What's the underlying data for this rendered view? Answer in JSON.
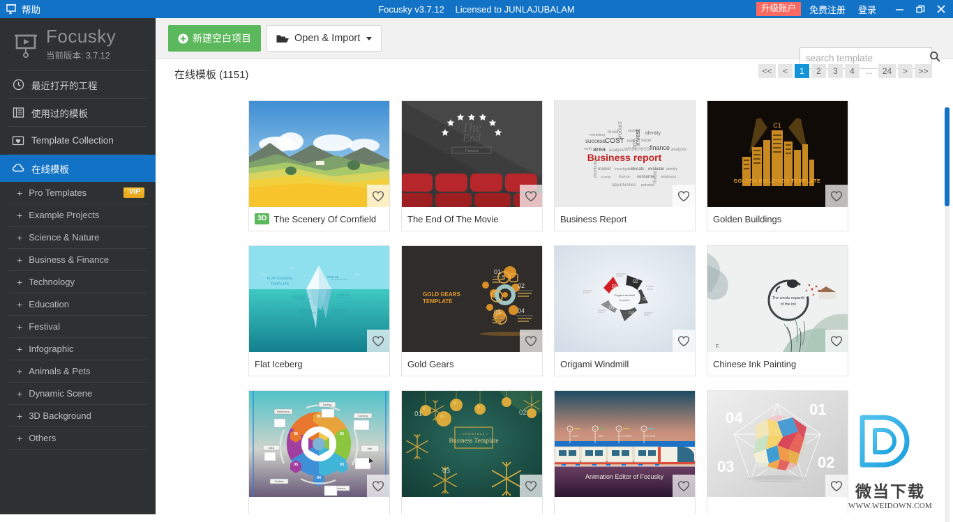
{
  "titlebar": {
    "app_icon": "focusky-app-icon",
    "help_label": "帮助",
    "product": "Focusky v3.7.12",
    "license": "Licensed to JUNLAJUBALAM",
    "upgrade_label": "升级账户",
    "register_label": "免费注册",
    "login_label": "登录",
    "minimize_icon": "minimize-icon",
    "maximize_icon": "restore-icon",
    "close_icon": "close-icon",
    "accent": "#1273c6",
    "upgrade_color": "#fa6a62"
  },
  "sidebar": {
    "brand_name": "Focusky",
    "version_label": "当前版本: 3.7.12",
    "items": [
      {
        "label": "最近打开的工程",
        "icon": "clock-icon",
        "active": false
      },
      {
        "label": "使用过的模板",
        "icon": "template-history-icon",
        "active": false
      },
      {
        "label": "Template Collection",
        "icon": "folder-heart-icon",
        "active": false
      },
      {
        "label": "在线模板",
        "icon": "cloud-icon",
        "active": true
      }
    ],
    "categories": [
      {
        "label": "Pro Templates",
        "vip": "VIP"
      },
      {
        "label": "Example Projects",
        "vip": ""
      },
      {
        "label": "Science & Nature",
        "vip": ""
      },
      {
        "label": "Business & Finance",
        "vip": ""
      },
      {
        "label": "Technology",
        "vip": ""
      },
      {
        "label": "Education",
        "vip": ""
      },
      {
        "label": "Festival",
        "vip": ""
      },
      {
        "label": "Infographic",
        "vip": ""
      },
      {
        "label": "Animals & Pets",
        "vip": ""
      },
      {
        "label": "Dynamic Scene",
        "vip": ""
      },
      {
        "label": "3D Background",
        "vip": ""
      },
      {
        "label": "Others",
        "vip": ""
      }
    ],
    "expand_symbol": "+"
  },
  "toolbar": {
    "new_project_label": "新建空白项目",
    "new_project_icon": "plus-circle-icon",
    "open_import_label": "Open & Import",
    "open_import_icon": "folder-open-icon",
    "dropdown_icon": "caret-down-icon"
  },
  "search": {
    "placeholder": "search template",
    "value": "",
    "icon": "search-icon"
  },
  "content": {
    "heading": "在线模板 (1151)",
    "pagination": {
      "first": "<<",
      "prev": "<",
      "pages": [
        "1",
        "2",
        "3",
        "4"
      ],
      "ellipsis": "...",
      "last_page": "24",
      "next": ">",
      "last": ">>",
      "current": "1",
      "active_color": "#1295d8"
    },
    "templates": [
      {
        "title": "The Scenery Of Cornfield",
        "badge": "3D",
        "art": "cornfield",
        "heart": "heart-outline-icon"
      },
      {
        "title": "The End Of The Movie",
        "badge": "",
        "art": "movie-end",
        "heart": "heart-outline-icon"
      },
      {
        "title": "Business Report",
        "badge": "",
        "art": "business-report",
        "heart": "heart-outline-icon"
      },
      {
        "title": "Golden Buildings",
        "badge": "",
        "art": "golden-buildings",
        "heart": "heart-outline-icon"
      },
      {
        "title": "Flat Iceberg",
        "badge": "",
        "art": "flat-iceberg",
        "heart": "heart-outline-icon"
      },
      {
        "title": "Gold Gears",
        "badge": "",
        "art": "gold-gears",
        "heart": "heart-outline-icon"
      },
      {
        "title": "Origami Windmill",
        "badge": "",
        "art": "origami-windmill",
        "heart": "heart-outline-icon"
      },
      {
        "title": "Chinese Ink Painting",
        "badge": "",
        "art": "chinese-ink",
        "heart": "heart-outline-icon"
      },
      {
        "title": "",
        "badge": "",
        "art": "infographic-wheel",
        "heart": "heart-outline-icon"
      },
      {
        "title": "",
        "badge": "",
        "art": "christmas-gold",
        "heart": "heart-outline-icon"
      },
      {
        "title": "",
        "badge": "",
        "art": "animation-train",
        "heart": "heart-outline-icon"
      },
      {
        "title": "",
        "badge": "",
        "art": "polygon-sphere",
        "heart": "heart-outline-icon"
      }
    ],
    "thumb_texts": {
      "movie_end_1": "The",
      "movie_end_2": "End",
      "movie_end_3": "Cinema",
      "business_report": "Business report",
      "golden_buildings": "GOLDEN BUILDINGS TEMPLATE",
      "golden_buildings_c1": "C1",
      "iceberg_1": "FLAT ICEBERG",
      "iceberg_2": "TEMPLATE",
      "gears_1": "GOLD GEARS",
      "gears_2": "TEMPLATE",
      "gears_nums": [
        "01",
        "02",
        "03",
        "04"
      ],
      "ink_1": "The words expanth",
      "ink_2": "of the ink",
      "christmas_1": "CHRISTMAS",
      "christmas_2": "Business Template",
      "christmas_nums": [
        "01",
        "02",
        "03"
      ],
      "train": "Animation Editor of Focusky",
      "sphere_nums": [
        "01",
        "02",
        "03",
        "04"
      ]
    }
  },
  "scrollbar": {
    "name": "vertical-scrollbar",
    "color": "#1273c6"
  },
  "watermark": {
    "cn": "微当下载",
    "url": "WWW.WEIDOWN.COM",
    "logo": "weidown-d-logo"
  }
}
